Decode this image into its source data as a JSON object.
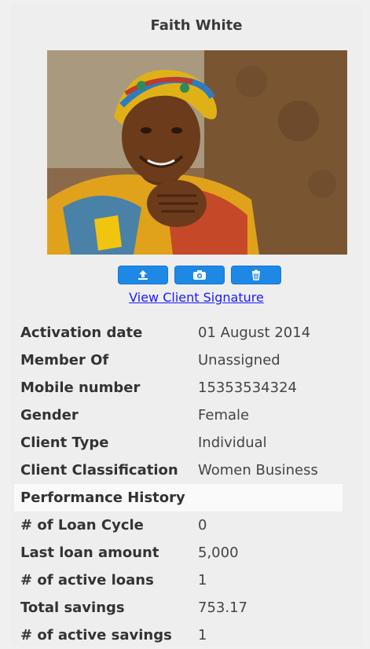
{
  "client": {
    "name": "Faith White",
    "photo_alt": "client photo"
  },
  "actions": [
    {
      "icon": "upload-icon"
    },
    {
      "icon": "camera-icon"
    },
    {
      "icon": "trash-icon"
    }
  ],
  "signature_link": "View Client Signature",
  "details": [
    {
      "label": "Activation date",
      "value": "01 August 2014"
    },
    {
      "label": "Member Of",
      "value": "Unassigned"
    },
    {
      "label": "Mobile number",
      "value": "15353534324"
    },
    {
      "label": "Gender",
      "value": "Female"
    },
    {
      "label": "Client Type",
      "value": "Individual"
    },
    {
      "label": "Client Classification",
      "value": "Women Business"
    }
  ],
  "performance_history": {
    "title": "Performance History",
    "rows": [
      {
        "label": "# of Loan Cycle",
        "value": "0"
      },
      {
        "label": "Last loan amount",
        "value": "5,000"
      },
      {
        "label": "# of active loans",
        "value": "1"
      },
      {
        "label": "Total savings",
        "value": "753.17"
      },
      {
        "label": "# of active savings",
        "value": "1"
      }
    ]
  },
  "colors": {
    "accent": "#1e88e5",
    "link": "#1a1aff"
  }
}
